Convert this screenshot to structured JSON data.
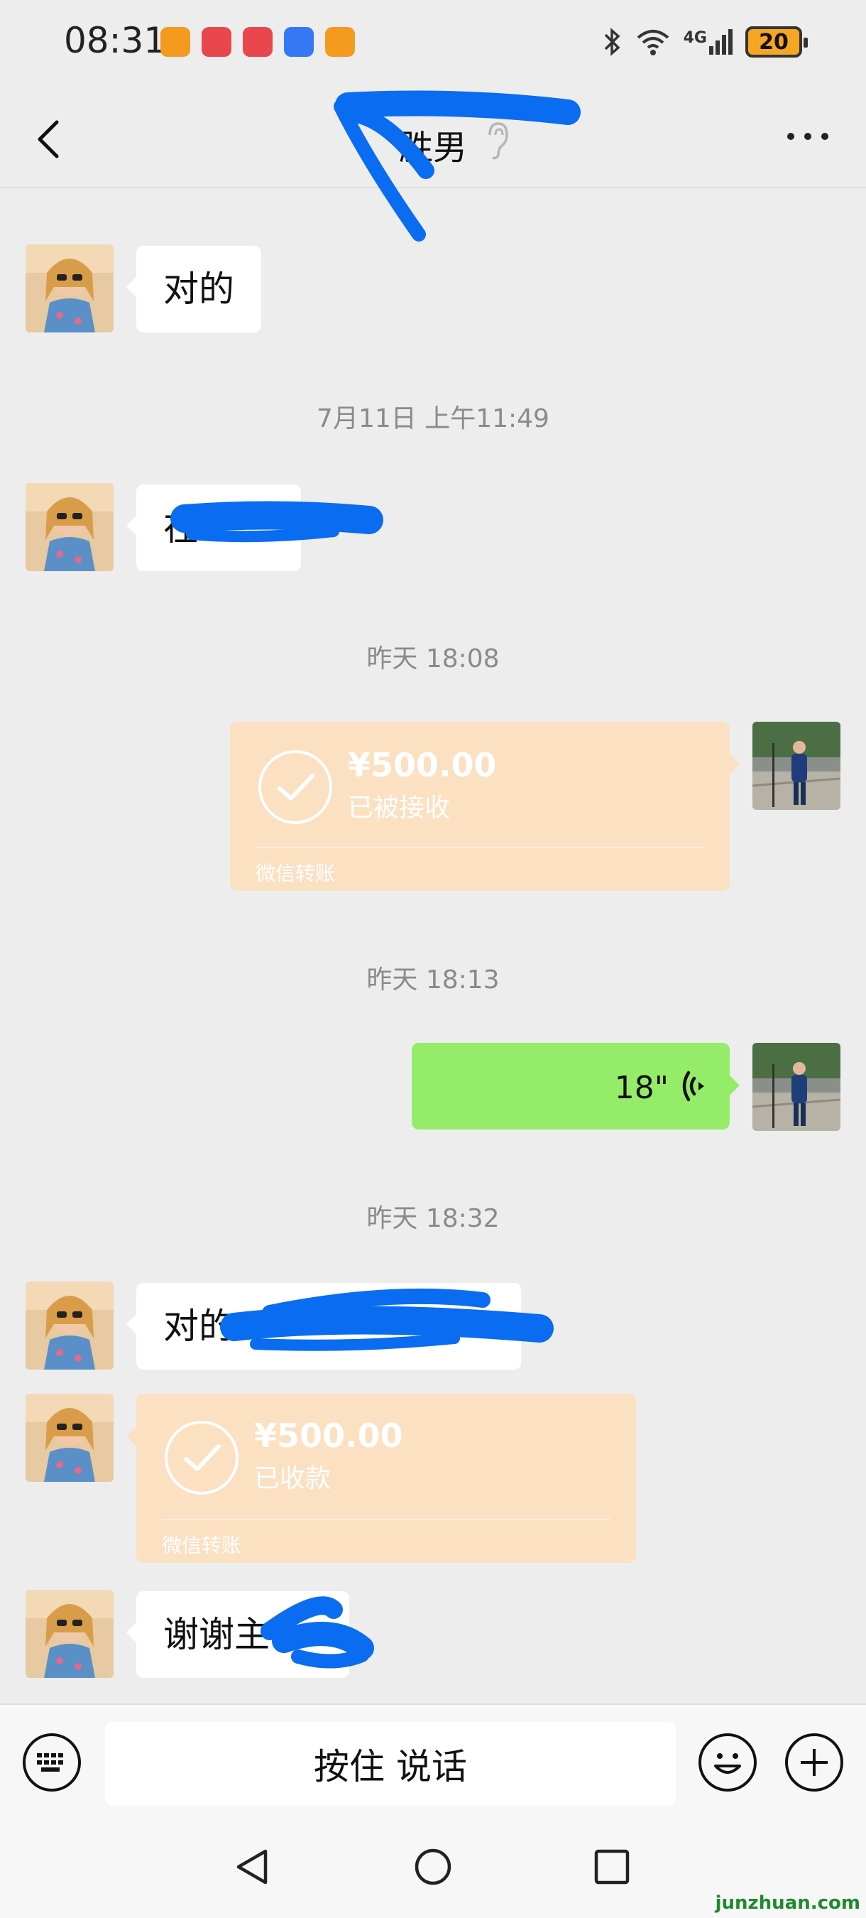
{
  "status_bar": {
    "time": "08:31",
    "network": "4G",
    "battery": "20",
    "app_icon_colors": [
      "#f39a1f",
      "#e8484d",
      "#e8484d",
      "#3478f6",
      "#f39a1f"
    ]
  },
  "header": {
    "title": "胜男"
  },
  "messages": [
    {
      "side": "left",
      "type": "text",
      "text": "对的"
    },
    {
      "type": "timestamp",
      "text": "7月11日 上午11:49"
    },
    {
      "side": "left",
      "type": "text",
      "text": "在"
    },
    {
      "type": "timestamp",
      "text": "昨天 18:08"
    },
    {
      "side": "right",
      "type": "transfer",
      "amount": "¥500.00",
      "status": "已被接收",
      "footer": "微信转账"
    },
    {
      "type": "timestamp",
      "text": "昨天 18:13"
    },
    {
      "side": "right",
      "type": "voice",
      "duration": "18\""
    },
    {
      "type": "timestamp",
      "text": "昨天 18:32"
    },
    {
      "side": "left",
      "type": "text",
      "text": "对的"
    },
    {
      "side": "left",
      "type": "transfer",
      "amount": "¥500.00",
      "status": "已收款",
      "footer": "微信转账"
    },
    {
      "side": "left",
      "type": "text",
      "text": "谢谢主"
    }
  ],
  "input_bar": {
    "hold_to_talk": "按住 说话"
  },
  "watermark": "junzhuan.com",
  "colors": {
    "background": "#ededed",
    "transfer_bubble": "#fbe0c2",
    "voice_bubble": "#95ec69",
    "redaction": "#0a6cf0"
  }
}
